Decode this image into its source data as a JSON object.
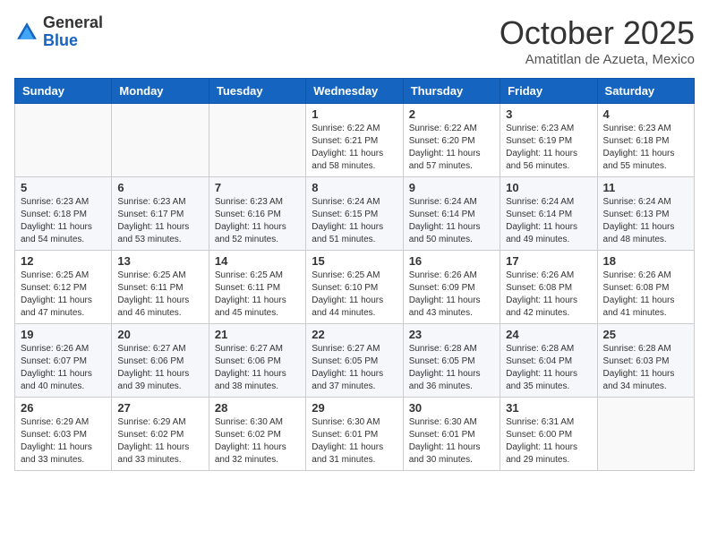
{
  "header": {
    "logo_general": "General",
    "logo_blue": "Blue",
    "month_title": "October 2025",
    "subtitle": "Amatitlan de Azueta, Mexico"
  },
  "weekdays": [
    "Sunday",
    "Monday",
    "Tuesday",
    "Wednesday",
    "Thursday",
    "Friday",
    "Saturday"
  ],
  "weeks": [
    [
      {
        "day": "",
        "info": ""
      },
      {
        "day": "",
        "info": ""
      },
      {
        "day": "",
        "info": ""
      },
      {
        "day": "1",
        "info": "Sunrise: 6:22 AM\nSunset: 6:21 PM\nDaylight: 11 hours and 58 minutes."
      },
      {
        "day": "2",
        "info": "Sunrise: 6:22 AM\nSunset: 6:20 PM\nDaylight: 11 hours and 57 minutes."
      },
      {
        "day": "3",
        "info": "Sunrise: 6:23 AM\nSunset: 6:19 PM\nDaylight: 11 hours and 56 minutes."
      },
      {
        "day": "4",
        "info": "Sunrise: 6:23 AM\nSunset: 6:18 PM\nDaylight: 11 hours and 55 minutes."
      }
    ],
    [
      {
        "day": "5",
        "info": "Sunrise: 6:23 AM\nSunset: 6:18 PM\nDaylight: 11 hours and 54 minutes."
      },
      {
        "day": "6",
        "info": "Sunrise: 6:23 AM\nSunset: 6:17 PM\nDaylight: 11 hours and 53 minutes."
      },
      {
        "day": "7",
        "info": "Sunrise: 6:23 AM\nSunset: 6:16 PM\nDaylight: 11 hours and 52 minutes."
      },
      {
        "day": "8",
        "info": "Sunrise: 6:24 AM\nSunset: 6:15 PM\nDaylight: 11 hours and 51 minutes."
      },
      {
        "day": "9",
        "info": "Sunrise: 6:24 AM\nSunset: 6:14 PM\nDaylight: 11 hours and 50 minutes."
      },
      {
        "day": "10",
        "info": "Sunrise: 6:24 AM\nSunset: 6:14 PM\nDaylight: 11 hours and 49 minutes."
      },
      {
        "day": "11",
        "info": "Sunrise: 6:24 AM\nSunset: 6:13 PM\nDaylight: 11 hours and 48 minutes."
      }
    ],
    [
      {
        "day": "12",
        "info": "Sunrise: 6:25 AM\nSunset: 6:12 PM\nDaylight: 11 hours and 47 minutes."
      },
      {
        "day": "13",
        "info": "Sunrise: 6:25 AM\nSunset: 6:11 PM\nDaylight: 11 hours and 46 minutes."
      },
      {
        "day": "14",
        "info": "Sunrise: 6:25 AM\nSunset: 6:11 PM\nDaylight: 11 hours and 45 minutes."
      },
      {
        "day": "15",
        "info": "Sunrise: 6:25 AM\nSunset: 6:10 PM\nDaylight: 11 hours and 44 minutes."
      },
      {
        "day": "16",
        "info": "Sunrise: 6:26 AM\nSunset: 6:09 PM\nDaylight: 11 hours and 43 minutes."
      },
      {
        "day": "17",
        "info": "Sunrise: 6:26 AM\nSunset: 6:08 PM\nDaylight: 11 hours and 42 minutes."
      },
      {
        "day": "18",
        "info": "Sunrise: 6:26 AM\nSunset: 6:08 PM\nDaylight: 11 hours and 41 minutes."
      }
    ],
    [
      {
        "day": "19",
        "info": "Sunrise: 6:26 AM\nSunset: 6:07 PM\nDaylight: 11 hours and 40 minutes."
      },
      {
        "day": "20",
        "info": "Sunrise: 6:27 AM\nSunset: 6:06 PM\nDaylight: 11 hours and 39 minutes."
      },
      {
        "day": "21",
        "info": "Sunrise: 6:27 AM\nSunset: 6:06 PM\nDaylight: 11 hours and 38 minutes."
      },
      {
        "day": "22",
        "info": "Sunrise: 6:27 AM\nSunset: 6:05 PM\nDaylight: 11 hours and 37 minutes."
      },
      {
        "day": "23",
        "info": "Sunrise: 6:28 AM\nSunset: 6:05 PM\nDaylight: 11 hours and 36 minutes."
      },
      {
        "day": "24",
        "info": "Sunrise: 6:28 AM\nSunset: 6:04 PM\nDaylight: 11 hours and 35 minutes."
      },
      {
        "day": "25",
        "info": "Sunrise: 6:28 AM\nSunset: 6:03 PM\nDaylight: 11 hours and 34 minutes."
      }
    ],
    [
      {
        "day": "26",
        "info": "Sunrise: 6:29 AM\nSunset: 6:03 PM\nDaylight: 11 hours and 33 minutes."
      },
      {
        "day": "27",
        "info": "Sunrise: 6:29 AM\nSunset: 6:02 PM\nDaylight: 11 hours and 33 minutes."
      },
      {
        "day": "28",
        "info": "Sunrise: 6:30 AM\nSunset: 6:02 PM\nDaylight: 11 hours and 32 minutes."
      },
      {
        "day": "29",
        "info": "Sunrise: 6:30 AM\nSunset: 6:01 PM\nDaylight: 11 hours and 31 minutes."
      },
      {
        "day": "30",
        "info": "Sunrise: 6:30 AM\nSunset: 6:01 PM\nDaylight: 11 hours and 30 minutes."
      },
      {
        "day": "31",
        "info": "Sunrise: 6:31 AM\nSunset: 6:00 PM\nDaylight: 11 hours and 29 minutes."
      },
      {
        "day": "",
        "info": ""
      }
    ]
  ]
}
